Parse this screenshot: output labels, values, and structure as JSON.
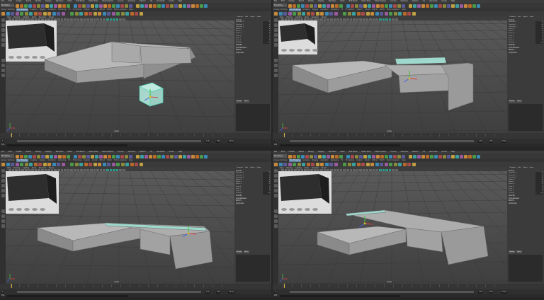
{
  "app": {
    "title": "Autodesk Maya"
  },
  "menus": [
    "File",
    "Edit",
    "Create",
    "Select",
    "Modify",
    "Display",
    "Windows",
    "Mesh",
    "Edit Mesh",
    "Mesh Tools",
    "Mesh Display",
    "Curves",
    "Surfaces",
    "Deform",
    "UV",
    "Generate",
    "Cache",
    "Help"
  ],
  "mode_selector": "Modeling",
  "shelf_tabs": [
    "Curves / Surfaces",
    "Poly Modeling",
    "Sculpting",
    "Rigging",
    "Animation",
    "Rendering",
    "FX",
    "FX Caching",
    "Custom",
    "Arnold",
    "Bifrost",
    "MASH",
    "Motion Graphics",
    "XGen"
  ],
  "active_shelf_index": 1,
  "viewport": {
    "menu": [
      "View",
      "Shading",
      "Lighting",
      "Show",
      "Renderer",
      "Panels"
    ],
    "camera_label": "persp"
  },
  "channel_box": {
    "tabs": [
      "Channels",
      "Edit",
      "Object",
      "Show"
    ],
    "object_name": "pCube1",
    "attributes": [
      {
        "name": "Translate X",
        "value": "0"
      },
      {
        "name": "Translate Y",
        "value": "0"
      },
      {
        "name": "Translate Z",
        "value": "0"
      },
      {
        "name": "Rotate X",
        "value": "0"
      },
      {
        "name": "Rotate Y",
        "value": "0"
      },
      {
        "name": "Rotate Z",
        "value": "0"
      },
      {
        "name": "Scale X",
        "value": "1"
      },
      {
        "name": "Scale Y",
        "value": "1"
      },
      {
        "name": "Scale Z",
        "value": "1"
      },
      {
        "name": "Visibility",
        "value": "on"
      }
    ],
    "shapes_label": "SHAPES",
    "shape_name": "pCubeShape1",
    "inputs_label": "INPUTS",
    "input_name": "polyCube1",
    "layer_tabs": [
      "Display",
      "Anim"
    ]
  },
  "range": {
    "start": "1",
    "end": "120",
    "range_end": "200",
    "fps": "24 fps"
  },
  "command": {
    "label": "MEL"
  },
  "colors": {
    "accent": "#5a7fa0",
    "selection": "#4fd3b4",
    "axis_x": "#e04040",
    "axis_y": "#40c040",
    "axis_z": "#4060e0",
    "playhead": "#d7b54a"
  }
}
